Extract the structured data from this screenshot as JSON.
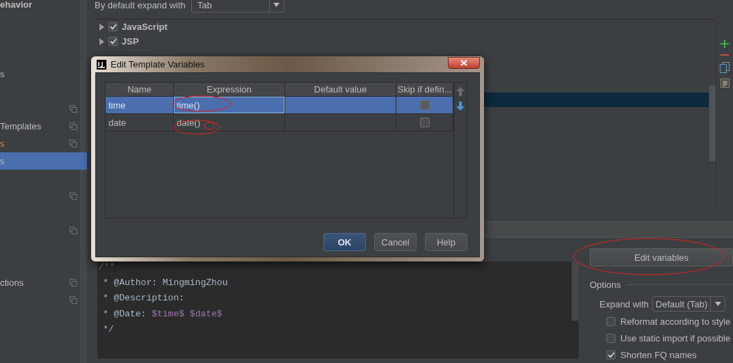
{
  "sidebar": {
    "items": [
      {
        "label": "ehavior",
        "kind": "group",
        "selected": false,
        "project_icon": false
      },
      {
        "kind": "blank"
      },
      {
        "kind": "blank"
      },
      {
        "kind": "blank"
      },
      {
        "label": "s",
        "kind": "item",
        "selected": false,
        "project_icon": false
      },
      {
        "kind": "blank"
      },
      {
        "kind": "item",
        "selected": false,
        "project_icon": true
      },
      {
        "label": "Templates",
        "kind": "item",
        "selected": false,
        "project_icon": true
      },
      {
        "label": "s",
        "kind": "modified",
        "selected": false,
        "project_icon": true
      },
      {
        "label": "s",
        "kind": "item",
        "selected": true,
        "project_icon": false
      },
      {
        "kind": "blank"
      },
      {
        "kind": "item",
        "selected": false,
        "project_icon": true
      },
      {
        "kind": "blank"
      },
      {
        "kind": "item",
        "selected": false,
        "project_icon": true
      },
      {
        "kind": "blank"
      },
      {
        "kind": "blank"
      },
      {
        "label": "ctions",
        "kind": "item",
        "selected": false,
        "project_icon": true
      },
      {
        "kind": "item",
        "selected": false,
        "project_icon": true
      }
    ]
  },
  "expand_default": {
    "label": "By default expand with",
    "value": "Tab"
  },
  "template_groups": [
    {
      "label": "JavaScript",
      "checked": true,
      "selected": false
    },
    {
      "label": "JSP",
      "checked": true,
      "selected": false
    },
    {
      "selected": false
    },
    {
      "selected": false
    },
    {
      "selected": false
    },
    {
      "selected": true
    }
  ],
  "template_text": {
    "lines": [
      [
        {
          "kind": "comment",
          "text": "/**"
        }
      ],
      [
        {
          "kind": "text",
          "text": "* @Author: MingmingZhou"
        }
      ],
      [
        {
          "kind": "text",
          "text": "* @Description:"
        }
      ],
      [
        {
          "kind": "text",
          "text": "* @Date: "
        },
        {
          "kind": "variable",
          "text": "$time$"
        },
        {
          "kind": "variable",
          "text": "$date$"
        }
      ],
      [
        {
          "kind": "text",
          "text": "*/"
        }
      ]
    ]
  },
  "edit_variables_button": "Edit variables",
  "options": {
    "title": "Options",
    "expand_with": {
      "label": "Expand with",
      "value": "Default (Tab)"
    },
    "checkboxes": [
      {
        "label": "Reformat according to style",
        "checked": false
      },
      {
        "label": "Use static import if possible",
        "checked": false
      },
      {
        "label": "Shorten FQ names",
        "checked": true
      }
    ]
  },
  "dialog": {
    "title": "Edit Template Variables",
    "columns": [
      "Name",
      "Expression",
      "Default value",
      "Skip if defin..."
    ],
    "rows": [
      {
        "name": "time",
        "expression": "time()",
        "skip": false,
        "selected": true
      },
      {
        "name": "date",
        "expression": "date()",
        "skip": false,
        "selected": false
      }
    ],
    "buttons": [
      {
        "label": "OK",
        "kind": "primary"
      },
      {
        "label": "Cancel",
        "kind": "normal"
      },
      {
        "label": "Help",
        "kind": "normal"
      }
    ]
  }
}
